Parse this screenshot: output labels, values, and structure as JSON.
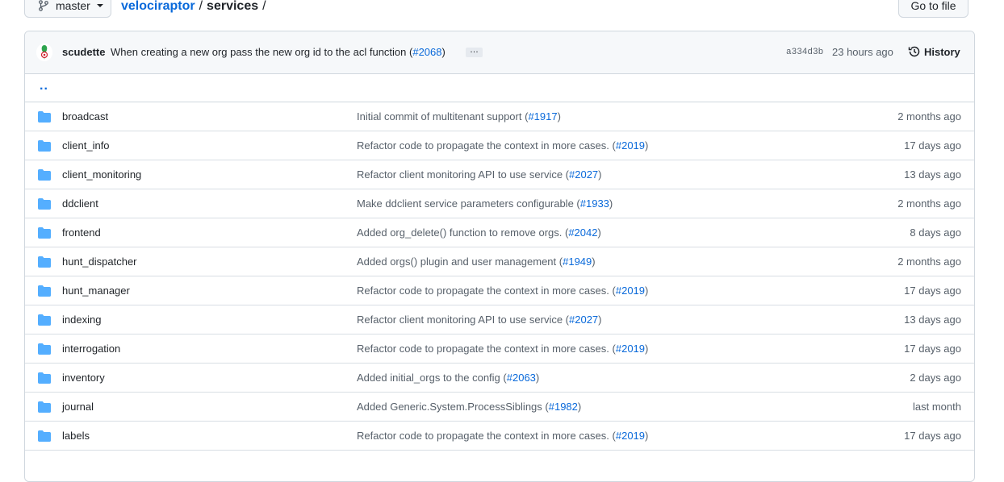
{
  "header": {
    "branch": "master",
    "breadcrumb": {
      "repo": "velociraptor",
      "sep1": "/",
      "dir": "services",
      "sep2": "/"
    },
    "goto_file": "Go to file"
  },
  "commit": {
    "author": "scudette",
    "message": "When creating a new org pass the new org id to the acl function",
    "pr": "#2068",
    "ellipsis": "…",
    "sha": "a334d3b",
    "time": "23 hours ago",
    "history_label": "History"
  },
  "parent_link": "..",
  "files": [
    {
      "name": "broadcast",
      "msg": "Initial commit of multitenant support",
      "pr": "#1917",
      "age": "2 months ago"
    },
    {
      "name": "client_info",
      "msg": "Refactor code to propagate the context in more cases.",
      "pr": "#2019",
      "age": "17 days ago"
    },
    {
      "name": "client_monitoring",
      "msg": "Refactor client monitoring API to use service",
      "pr": "#2027",
      "age": "13 days ago"
    },
    {
      "name": "ddclient",
      "msg": "Make ddclient service parameters configurable",
      "pr": "#1933",
      "age": "2 months ago"
    },
    {
      "name": "frontend",
      "msg": "Added org_delete() function to remove orgs.",
      "pr": "#2042",
      "age": "8 days ago"
    },
    {
      "name": "hunt_dispatcher",
      "msg": "Added orgs() plugin and user management",
      "pr": "#1949",
      "age": "2 months ago"
    },
    {
      "name": "hunt_manager",
      "msg": "Refactor code to propagate the context in more cases.",
      "pr": "#2019",
      "age": "17 days ago"
    },
    {
      "name": "indexing",
      "msg": "Refactor client monitoring API to use service",
      "pr": "#2027",
      "age": "13 days ago"
    },
    {
      "name": "interrogation",
      "msg": "Refactor code to propagate the context in more cases.",
      "pr": "#2019",
      "age": "17 days ago"
    },
    {
      "name": "inventory",
      "msg": "Added initial_orgs to the config",
      "pr": "#2063",
      "age": "2 days ago"
    },
    {
      "name": "journal",
      "msg": "Added Generic.System.ProcessSiblings",
      "pr": "#1982",
      "age": "last month"
    },
    {
      "name": "labels",
      "msg": "Refactor code to propagate the context in more cases.",
      "pr": "#2019",
      "age": "17 days ago"
    }
  ],
  "colors": {
    "link": "#0969da",
    "folder": "#54aeff",
    "border": "#d0d7de",
    "muted": "#57606a"
  },
  "icons": {
    "branch": "git-branch-icon",
    "folder": "folder-icon",
    "history": "history-clock-icon"
  }
}
